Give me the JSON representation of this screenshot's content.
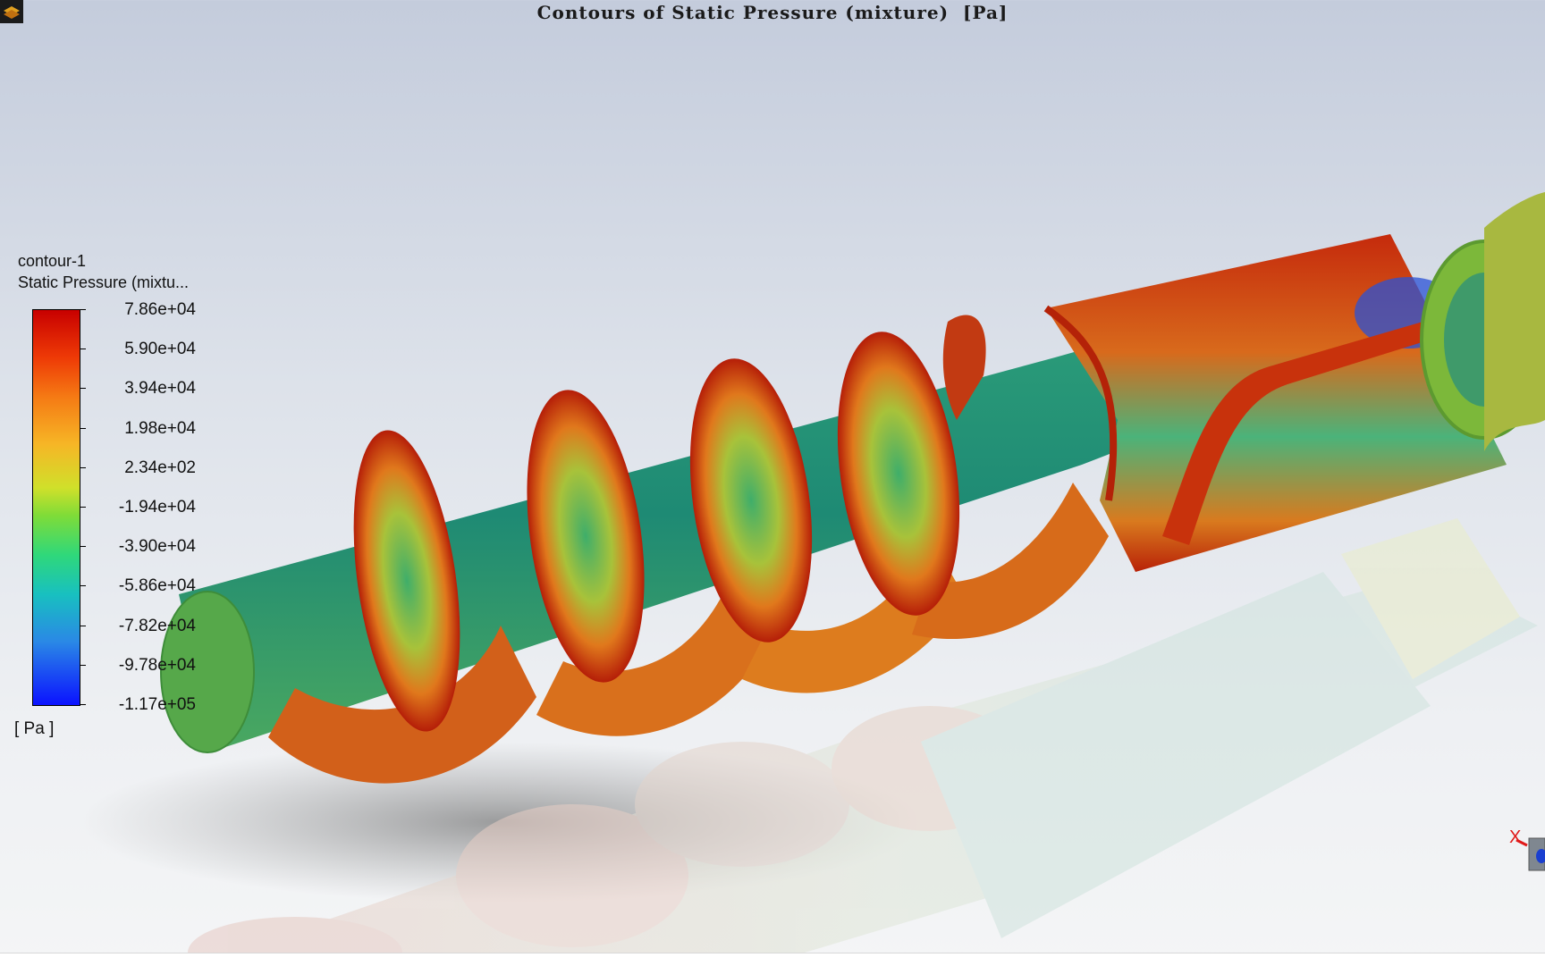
{
  "window": {
    "app_icon": "fluent-app-icon",
    "title": "Contours of Static Pressure (mixture)  [Pa]"
  },
  "legend": {
    "name": "contour-1",
    "field": "Static Pressure (mixtu...",
    "units": "[ Pa ]",
    "colormap": [
      "#c80000",
      "#f57a14",
      "#f6b626",
      "#7fdc38",
      "#18c0c0",
      "#0b12ff"
    ],
    "ticks": [
      "7.86e+04",
      "5.90e+04",
      "3.94e+04",
      "1.98e+04",
      "2.34e+02",
      "-1.94e+04",
      "-3.90e+04",
      "-5.86e+04",
      "-7.82e+04",
      "-9.78e+04",
      "-1.17e+05"
    ]
  },
  "axis_triad": {
    "x_label": "X"
  }
}
